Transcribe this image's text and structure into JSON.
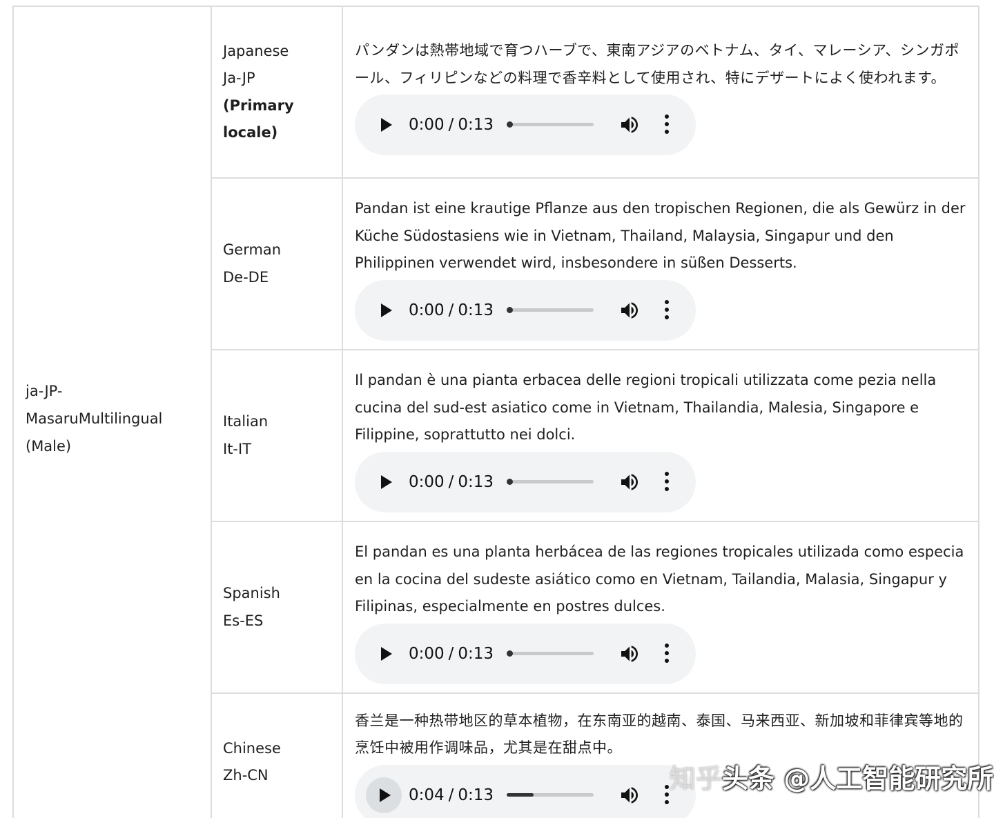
{
  "voice": {
    "line1": "ja-JP-",
    "line2": "MasaruMultilingual",
    "line3": "(Male)"
  },
  "rows": [
    {
      "locale_name": "Japanese",
      "locale_code": "Ja-JP",
      "primary_label_1": "(Primary",
      "primary_label_2": "locale)",
      "text": "パンダンは熱帯地域で育つハーブで、東南アジアのベトナム、タイ、マレーシア、シンガポール、フィリピンなどの料理で香辛料として使用され、特にデザートによく使われます。",
      "current_time": "0:00",
      "duration": "0:13",
      "progress": 0.0
    },
    {
      "locale_name": "German",
      "locale_code": "De-DE",
      "text": "Pandan ist eine krautige Pflanze aus den tropischen Regionen, die als Gewürz in der Küche Südostasiens wie in Vietnam, Thailand, Malaysia, Singapur und den Philippinen verwendet wird, insbesondere in süßen Desserts.",
      "current_time": "0:00",
      "duration": "0:13",
      "progress": 0.0
    },
    {
      "locale_name": "Italian",
      "locale_code": "It-IT",
      "text": "Il pandan è una pianta erbacea delle regioni tropicali utilizzata come pezia nella cucina del sud-est asiatico come in Vietnam, Thailandia, Malesia, Singapore e Filippine, soprattutto nei dolci.",
      "current_time": "0:00",
      "duration": "0:13",
      "progress": 0.0
    },
    {
      "locale_name": "Spanish",
      "locale_code": "Es-ES",
      "text": "El pandan es una planta herbácea de las regiones tropicales utilizada como especia en la cocina del sudeste asiático como en Vietnam, Tailandia, Malasia, Singapur y Filipinas, especialmente en postres dulces.",
      "current_time": "0:00",
      "duration": "0:13",
      "progress": 0.0
    },
    {
      "locale_name": "Chinese",
      "locale_code": "Zh-CN",
      "text": "香兰是一种热带地区的草本植物，在东南亚的越南、泰国、马来西亚、新加坡和菲律宾等地的烹饪中被用作调味品，尤其是在甜点中。",
      "current_time": "0:04",
      "duration": "0:13",
      "progress": 0.31
    }
  ],
  "player": {
    "time_separator": "/",
    "icons": [
      "play-icon",
      "volume-icon",
      "more-options-icon"
    ]
  },
  "watermark": {
    "faint": "知乎",
    "main": "头条 @人工智能研究所"
  },
  "colors": {
    "player_bg": "#f1f3f4",
    "border": "#dddddd",
    "track": "#c7c9cb",
    "track_fill": "#333333"
  }
}
